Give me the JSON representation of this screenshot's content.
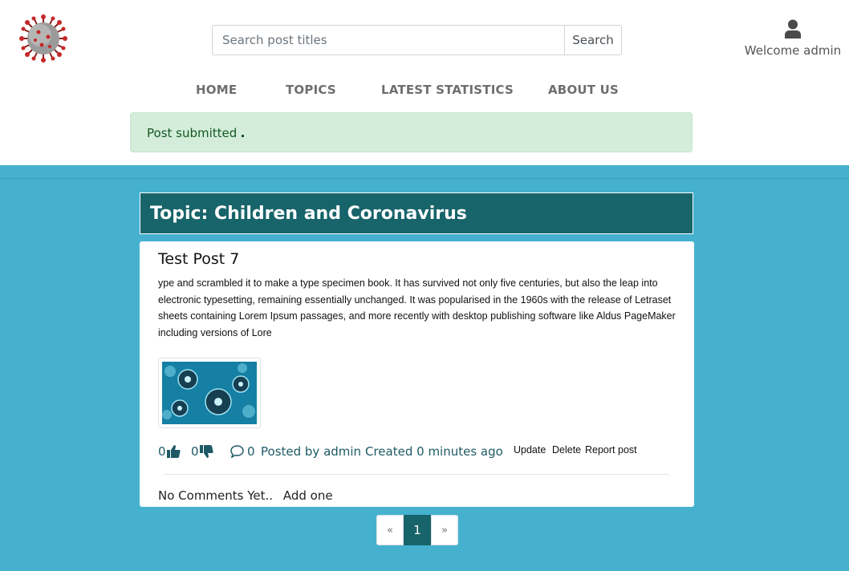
{
  "header": {
    "search": {
      "placeholder": "Search post titles",
      "value": "",
      "button_label": "Search"
    },
    "user": {
      "welcome_text": "Welcome admin",
      "icon": "user-icon"
    },
    "logo_icon": "coronavirus-logo"
  },
  "nav": {
    "items": [
      {
        "label": "HOME"
      },
      {
        "label": "TOPICS"
      },
      {
        "label": "LATEST STATISTICS"
      },
      {
        "label": "ABOUT US"
      }
    ]
  },
  "alert": {
    "message": "Post submitted"
  },
  "topic": {
    "title": "Topic: Children and Coronavirus"
  },
  "post": {
    "title": "Test Post 7",
    "body": "ype and scrambled it to make a type specimen book. It has survived not only five centuries, but also the leap into electronic typesetting, remaining essentially unchanged. It was popularised in the 1960s with the release of Letraset sheets containing Lorem Ipsum passages, and more recently with desktop publishing software like Aldus PageMaker including versions of Lore",
    "likes": "0",
    "dislikes": "0",
    "comments_count": "0",
    "posted_by": "Posted by admin",
    "created": "Created 0 minutes ago",
    "actions": {
      "update": "Update",
      "delete": "Delete",
      "report": "Report post"
    },
    "comments_text": "No Comments Yet..",
    "add_comment": "Add one"
  },
  "pagination": {
    "prev": "«",
    "current": "1",
    "next": "»"
  },
  "colors": {
    "accent": "#17646a",
    "background_blue": "#45b1cf",
    "alert_bg": "#d4edda",
    "alert_text": "#155724"
  }
}
